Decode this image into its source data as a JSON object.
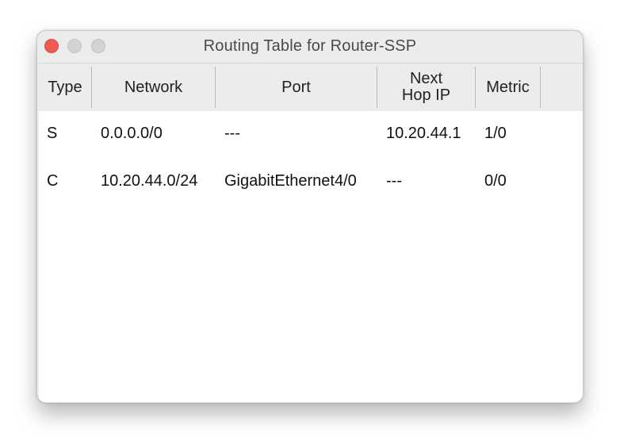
{
  "window": {
    "title": "Routing Table for Router-SSP"
  },
  "table": {
    "columns": [
      "Type",
      "Network",
      "Port",
      "Next\nHop IP",
      "Metric"
    ],
    "rows": [
      [
        "S",
        "0.0.0.0/0",
        "---",
        "10.20.44.1",
        "1/0"
      ],
      [
        "C",
        "10.20.44.0/24",
        "GigabitEthernet4/0",
        "---",
        "0/0"
      ]
    ]
  },
  "colors": {
    "close_button": "#ee5b56",
    "inactive_button": "#d3d3d3",
    "header_background": "#ececec"
  }
}
